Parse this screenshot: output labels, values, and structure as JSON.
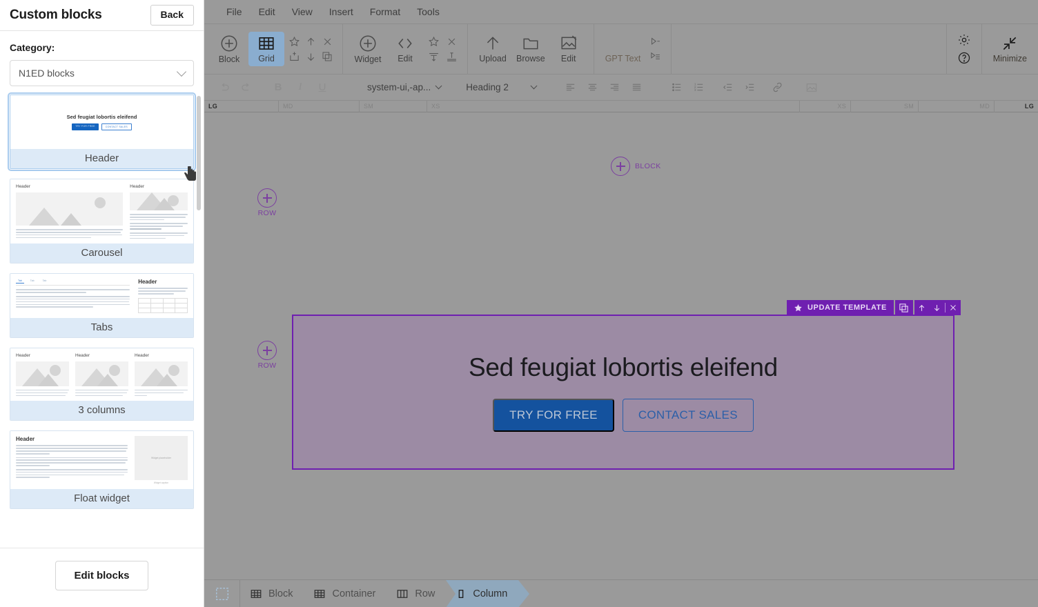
{
  "sidebar": {
    "title": "Custom blocks",
    "back_label": "Back",
    "category_label": "Category:",
    "category_value": "N1ED blocks",
    "edit_blocks_label": "Edit blocks",
    "blocks": [
      {
        "name": "Header",
        "selected": true,
        "preview": {
          "kind": "hero",
          "title": "Sed feugiat lobortis eleifend",
          "primary_btn": "TRY FOR FREE",
          "secondary_btn": "CONTACT SALES"
        }
      },
      {
        "name": "Carousel",
        "selected": false,
        "preview": {
          "kind": "carousel",
          "left_header": "Header",
          "right_header": "Header"
        }
      },
      {
        "name": "Tabs",
        "selected": false,
        "preview": {
          "kind": "tabs",
          "tabs": [
            "Tab",
            "Tab",
            "Tab"
          ],
          "side_header": "Header"
        }
      },
      {
        "name": "3 columns",
        "selected": false,
        "preview": {
          "kind": "columns3",
          "headers": [
            "Header",
            "Header",
            "Header"
          ]
        }
      },
      {
        "name": "Float widget",
        "selected": false,
        "preview": {
          "kind": "float",
          "header": "Header",
          "widget_placeholder": "Widget placeholder",
          "widget_caption": "Widget caption"
        }
      }
    ]
  },
  "editor": {
    "menubar": [
      "File",
      "Edit",
      "View",
      "Insert",
      "Format",
      "Tools"
    ],
    "toolbar": {
      "block_label": "Block",
      "grid_label": "Grid",
      "widget_label": "Widget",
      "edit_label": "Edit",
      "upload_label": "Upload",
      "browse_label": "Browse",
      "image_edit_label": "Edit",
      "gpt_text_label": "GPT Text",
      "minimize_label": "Minimize",
      "icons": {
        "block": "plus-circle-icon",
        "grid": "grid-icon",
        "favorite": "star-icon",
        "move_up": "arrow-up-icon",
        "remove": "close-icon",
        "insert": "insert-box-icon",
        "move_down": "arrow-down-icon",
        "duplicate": "copy-icon",
        "widget": "plus-circle-icon",
        "code": "code-icon",
        "widget_star": "star-icon",
        "widget_close": "close-icon",
        "align_top": "align-top-icon",
        "align_bottom": "align-bottom-icon",
        "upload": "arrow-up-icon",
        "browse": "folder-icon",
        "image_edit": "image-edit-icon",
        "gpt_text": "play-icon",
        "gpt_line": "play-line-icon",
        "gpt_list": "play-list-icon",
        "settings": "gear-icon",
        "help": "question-circle-icon",
        "minimize": "minimize-arrows-icon"
      }
    },
    "format_bar": {
      "undo": "undo-icon",
      "redo": "redo-icon",
      "bold": "B",
      "italic": "I",
      "underline": "U",
      "font_family": "system-ui,-ap...",
      "block_format": "Heading 2",
      "align_left": "align-left-icon",
      "align_center": "align-center-icon",
      "align_right": "align-right-icon",
      "align_justify": "align-justify-icon",
      "bullet_list": "bullet-list-icon",
      "numbered_list": "numbered-list-icon",
      "outdent": "outdent-icon",
      "indent": "indent-icon",
      "link": "link-icon",
      "image": "image-icon"
    },
    "ruler": {
      "left": [
        "LG",
        "MD",
        "SM",
        "XS"
      ],
      "right": [
        "XS",
        "SM",
        "MD",
        "LG"
      ],
      "active": "LG"
    },
    "canvas": {
      "add_block_top": "BLOCK",
      "add_block_bottom": "BLOCK",
      "add_row_top": "ROW",
      "add_row_bottom": "ROW",
      "template_bar": {
        "update_label": "UPDATE TEMPLATE",
        "star_icon": "star-icon",
        "duplicate_icon": "copy-icon",
        "up_icon": "arrow-up-icon",
        "down_icon": "arrow-down-icon",
        "close_icon": "close-icon"
      },
      "hero": {
        "title": "Sed feugiat lobortis eleifend",
        "primary_btn": "TRY FOR FREE",
        "secondary_btn": "CONTACT SALES"
      }
    },
    "statusbar": {
      "select_icon": "select-all-icon",
      "crumbs": [
        {
          "label": "Block",
          "icon": "grid-icon",
          "active": false
        },
        {
          "label": "Container",
          "icon": "grid-icon",
          "active": false
        },
        {
          "label": "Row",
          "icon": "columns-icon",
          "active": false
        },
        {
          "label": "Column",
          "icon": "column-icon",
          "active": true
        }
      ]
    }
  },
  "colors": {
    "accent_purple": "#6f1fb0",
    "canvas_gray": "#9a9a9a",
    "row_fill": "#9c8ba4",
    "primary_blue": "#14529e",
    "thumb_label_bg": "#ddeaf7"
  }
}
